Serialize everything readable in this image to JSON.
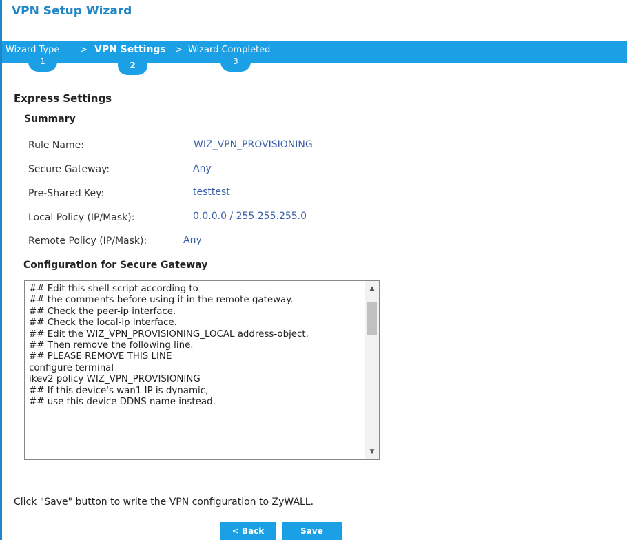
{
  "window": {
    "title": "VPN Setup Wizard"
  },
  "steps": [
    {
      "label": "Wizard Type",
      "number": "1"
    },
    {
      "label": "VPN Settings",
      "number": "2"
    },
    {
      "label": "Wizard Completed",
      "number": "3"
    }
  ],
  "step_separator": ">",
  "express": {
    "heading": "Express Settings"
  },
  "summary": {
    "heading": "Summary",
    "rows": [
      {
        "label": "Rule Name:",
        "value": "WIZ_VPN_PROVISIONING"
      },
      {
        "label": "Secure Gateway:",
        "value": "Any"
      },
      {
        "label": "Pre-Shared Key:",
        "value": "testtest"
      },
      {
        "label": "Local Policy (IP/Mask):",
        "value": "0.0.0.0 / 255.255.255.0"
      },
      {
        "label": "Remote Policy (IP/Mask):",
        "value": "Any"
      }
    ]
  },
  "config": {
    "heading": "Configuration for Secure Gateway",
    "script": "## Edit this shell script according to\n## the comments before using it in the remote gateway.\n## Check the peer-ip interface.\n## Check the local-ip interface.\n## Edit the WIZ_VPN_PROVISIONING_LOCAL address-object.\n## Then remove the following line.\n## PLEASE REMOVE THIS LINE\nconfigure terminal\nikev2 policy WIZ_VPN_PROVISIONING\n## If this device's wan1 IP is dynamic,\n## use this device DDNS name instead.",
    "scroll_up_icon": "▲",
    "scroll_down_icon": "▼"
  },
  "footer": {
    "message": "Click \"Save\" button to write the VPN configuration to ZyWALL.",
    "back_label": "< Back",
    "save_label": "Save"
  },
  "colors": {
    "accent": "#1ba0e6",
    "title": "#1f86c8",
    "value_text": "#3a5fa8"
  }
}
